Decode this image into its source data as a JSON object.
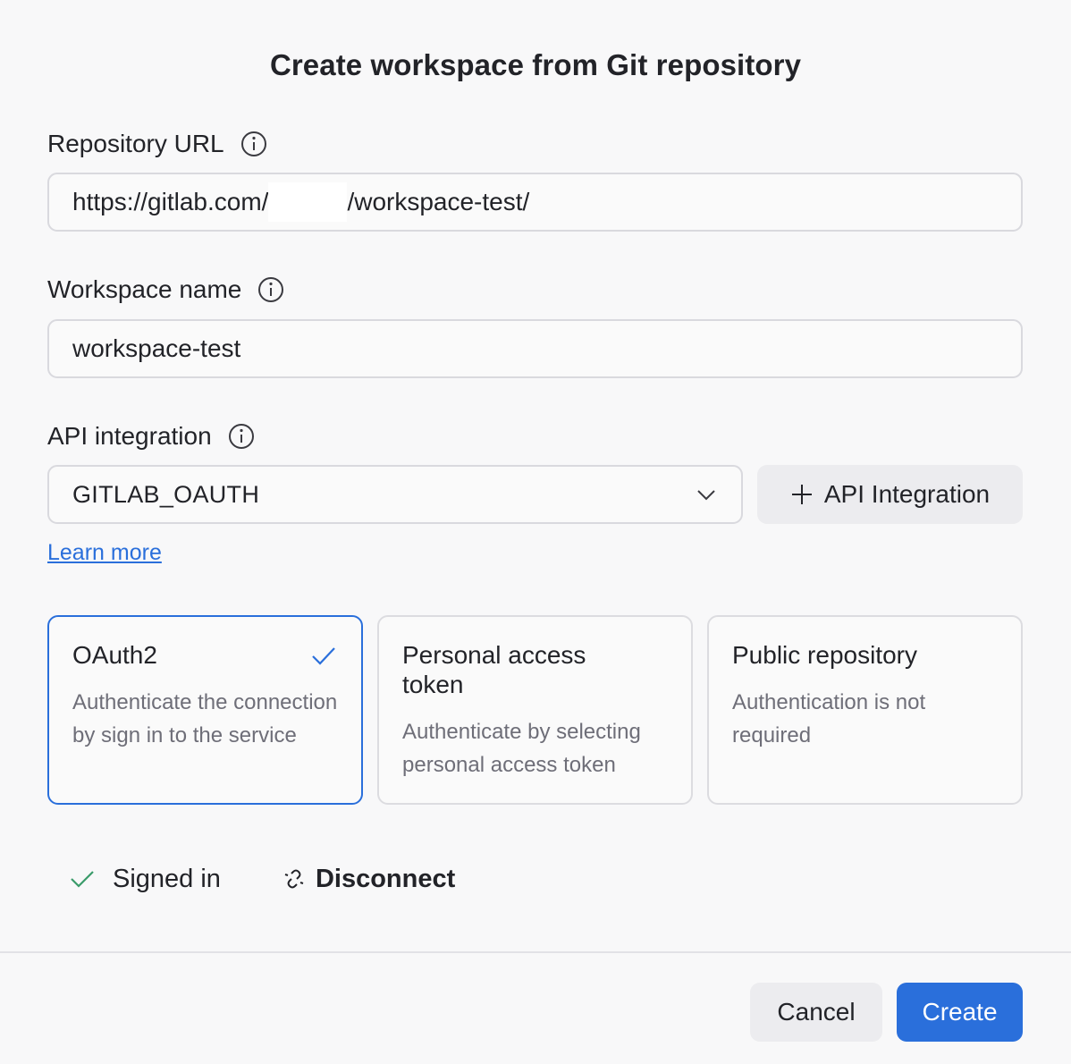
{
  "dialog": {
    "title": "Create workspace from Git repository"
  },
  "repository_url": {
    "label": "Repository URL",
    "value_prefix": "https://gitlab.com/",
    "value_suffix": "/workspace-test/"
  },
  "workspace_name": {
    "label": "Workspace name",
    "value": "workspace-test"
  },
  "api_integration": {
    "label": "API integration",
    "selected": "GITLAB_OAUTH",
    "add_button_label": "API Integration",
    "learn_more": "Learn more"
  },
  "auth_options": [
    {
      "title": "OAuth2",
      "description": "Authenticate the connection by sign in to the service",
      "selected": true
    },
    {
      "title": "Personal access token",
      "description": "Authenticate by selecting personal access token",
      "selected": false
    },
    {
      "title": "Public repository",
      "description": "Authentication is not required",
      "selected": false
    }
  ],
  "auth_status": {
    "signed_in": "Signed in",
    "disconnect": "Disconnect"
  },
  "footer": {
    "cancel": "Cancel",
    "create": "Create"
  },
  "colors": {
    "accent": "#2a6fdb",
    "success": "#3a9b6a"
  }
}
